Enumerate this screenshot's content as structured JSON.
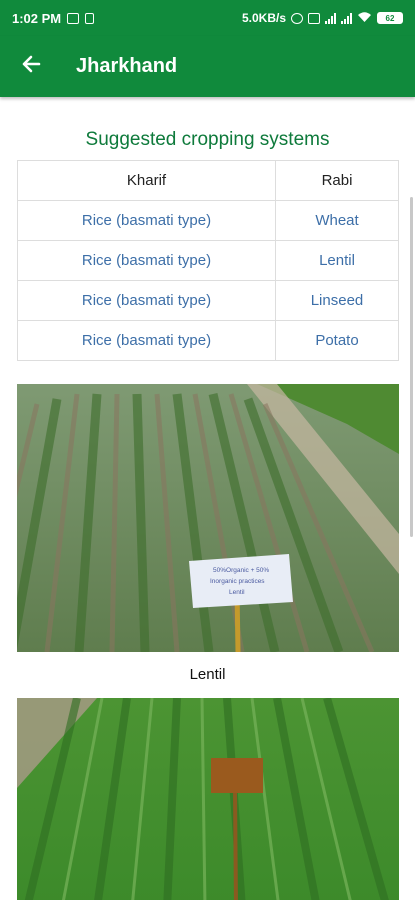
{
  "status_bar": {
    "time": "1:02 PM",
    "net_speed": "5.0KB/s",
    "battery": "62"
  },
  "app_bar": {
    "title": "Jharkhand",
    "back_icon": "arrow-left-icon"
  },
  "section": {
    "title": "Suggested cropping systems"
  },
  "table": {
    "headers": [
      "Kharif",
      "Rabi"
    ],
    "rows": [
      [
        "Rice (basmati type)",
        "Wheat"
      ],
      [
        "Rice (basmati type)",
        "Lentil"
      ],
      [
        "Rice (basmati type)",
        "Linseed"
      ],
      [
        "Rice (basmati type)",
        "Potato"
      ]
    ]
  },
  "photos": [
    {
      "sign_text": [
        "50%Organic + 50%",
        "Inorganic practices",
        "Lentil"
      ],
      "caption": "Lentil"
    }
  ],
  "colors": {
    "primary": "#108a3c",
    "section_title": "#0e7a3b",
    "link_text": "#3d6fa8"
  }
}
